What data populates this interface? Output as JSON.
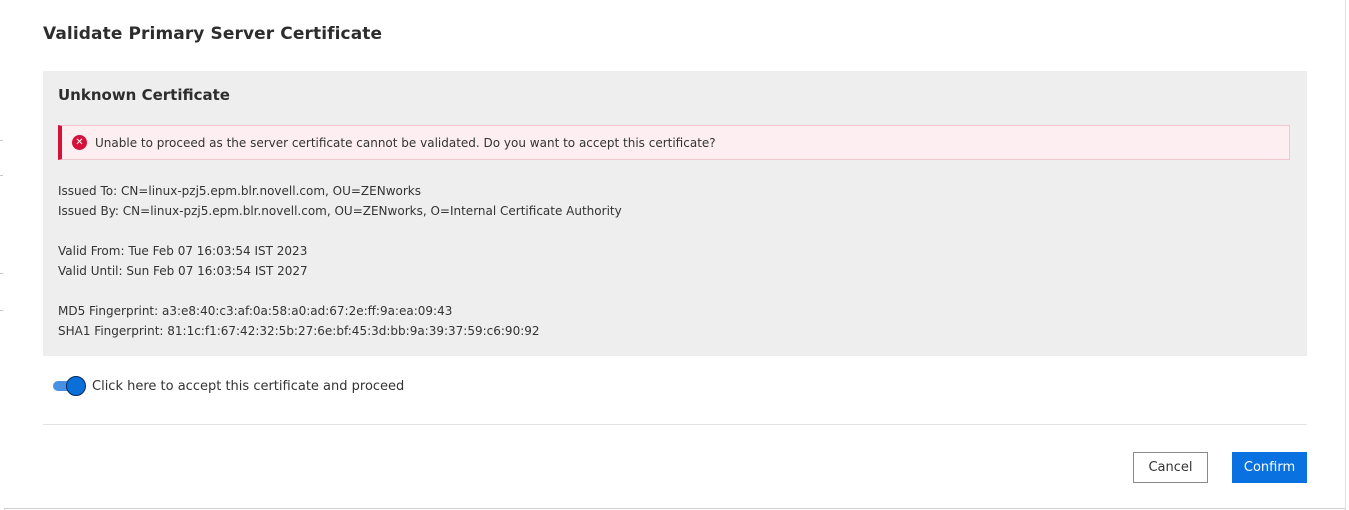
{
  "dialog": {
    "title": "Validate Primary Server Certificate"
  },
  "certificate": {
    "heading": "Unknown Certificate",
    "alert": {
      "icon": "error-circle-icon",
      "text": "Unable to proceed as the server certificate cannot be validated. Do you want to accept this certificate?"
    },
    "issued_to": "Issued To: CN=linux-pzj5.epm.blr.novell.com, OU=ZENworks",
    "issued_by": "Issued By: CN=linux-pzj5.epm.blr.novell.com, OU=ZENworks, O=Internal Certificate Authority",
    "valid_from": "Valid From: Tue Feb 07 16:03:54 IST 2023",
    "valid_until": "Valid Until: Sun Feb 07 16:03:54 IST 2027",
    "md5": "MD5 Fingerprint: a3:e8:40:c3:af:0a:58:a0:ad:67:2e:ff:9a:ea:09:43",
    "sha1": "SHA1 Fingerprint: 81:1c:f1:67:42:32:5b:27:6e:bf:45:3d:bb:9a:39:37:59:c6:90:92"
  },
  "accept_toggle": {
    "label": "Click here to accept this certificate and proceed",
    "checked": true
  },
  "footer": {
    "cancel_label": "Cancel",
    "confirm_label": "Confirm"
  },
  "colors": {
    "accent": "#0a72e0",
    "error": "#d5113a",
    "panel_bg": "#eeeeee",
    "alert_bg": "#fdeff1"
  }
}
